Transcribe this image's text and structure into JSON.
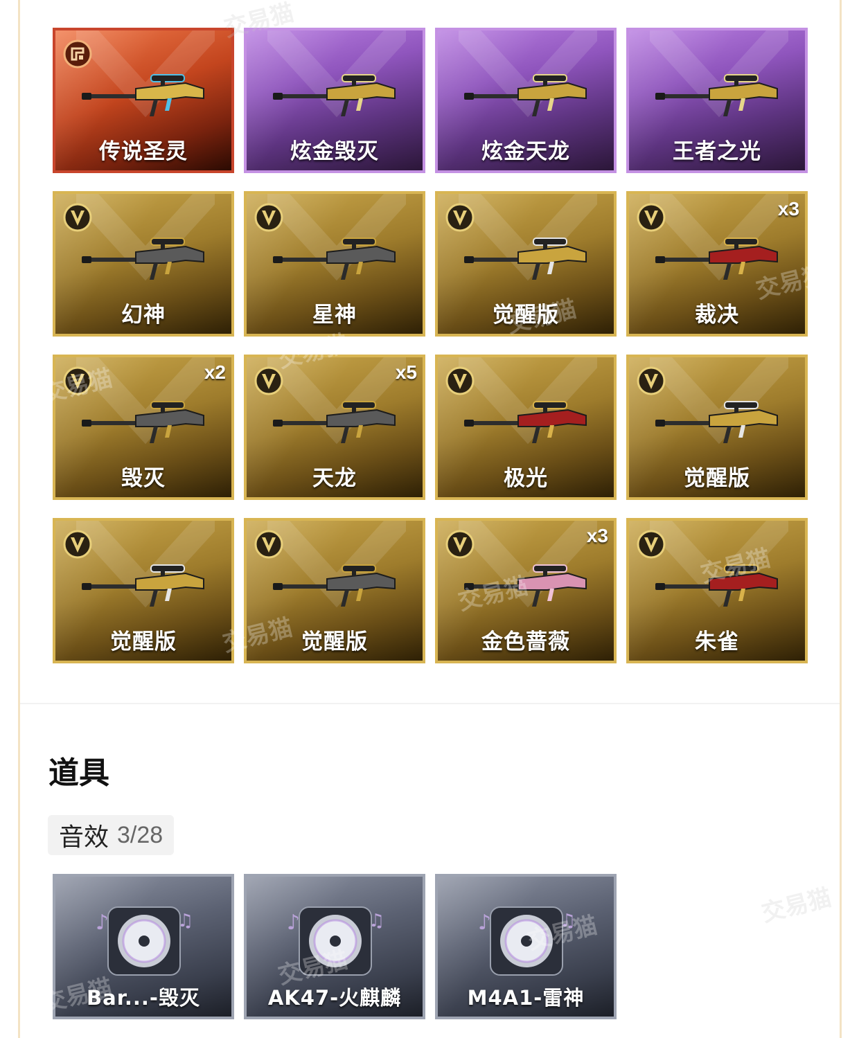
{
  "weapons": [
    {
      "name": "传说圣灵",
      "tier": "legend",
      "count": ""
    },
    {
      "name": "炫金毁灭",
      "tier": "purple",
      "count": ""
    },
    {
      "name": "炫金天龙",
      "tier": "purple",
      "count": ""
    },
    {
      "name": "王者之光",
      "tier": "purple",
      "count": ""
    },
    {
      "name": "幻神",
      "tier": "gold",
      "count": ""
    },
    {
      "name": "星神",
      "tier": "gold",
      "count": ""
    },
    {
      "name": "觉醒版",
      "tier": "gold",
      "count": ""
    },
    {
      "name": "裁决",
      "tier": "gold",
      "count": "x3"
    },
    {
      "name": "毁灭",
      "tier": "gold",
      "count": "x2"
    },
    {
      "name": "天龙",
      "tier": "gold",
      "count": "x5"
    },
    {
      "name": "极光",
      "tier": "gold",
      "count": ""
    },
    {
      "name": "觉醒版",
      "tier": "gold",
      "count": ""
    },
    {
      "name": "觉醒版",
      "tier": "gold",
      "count": ""
    },
    {
      "name": "觉醒版",
      "tier": "gold",
      "count": ""
    },
    {
      "name": "金色蔷薇",
      "tier": "gold",
      "count": "x3"
    },
    {
      "name": "朱雀",
      "tier": "gold",
      "count": ""
    }
  ],
  "props_section": {
    "title": "道具",
    "category": {
      "name": "音效",
      "count": "3/28"
    },
    "items": [
      {
        "name": "Bar...-毁灭"
      },
      {
        "name": "AK47-火麒麟"
      },
      {
        "name": "M4A1-雷神"
      }
    ]
  },
  "watermark": "交易猫",
  "colors": {
    "gold_border": "#d8b553",
    "purple_border": "#c491e3",
    "legend_border": "#c8452c",
    "sound_border": "#9ea4b2"
  }
}
